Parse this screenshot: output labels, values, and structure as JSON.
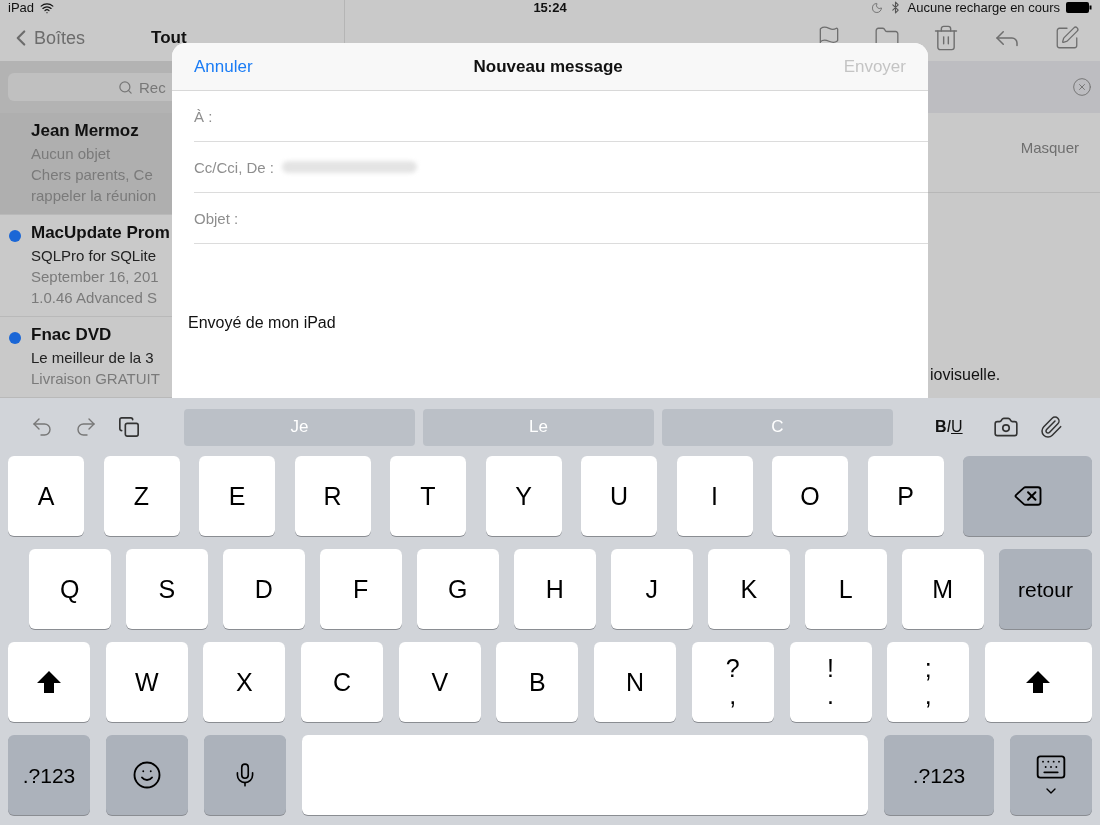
{
  "status_bar": {
    "carrier": "iPad",
    "time": "15:24",
    "charging": "Aucune recharge en cours"
  },
  "mailbox": {
    "back": "Boîtes",
    "title": "Tout",
    "search_placeholder": "Rec",
    "messages": [
      {
        "sender": "Jean Mermoz",
        "subject": "Aucun objet",
        "preview": [
          "Chers parents, Ce",
          "rappeler la réunion"
        ],
        "selected": true,
        "unread": false
      },
      {
        "sender": "MacUpdate Prom",
        "subject": "SQLPro for SQLite",
        "preview": [
          "September 16, 201",
          "1.0.46 Advanced S"
        ],
        "selected": false,
        "unread": true
      },
      {
        "sender": "Fnac DVD",
        "subject": "Le meilleur de la 3",
        "preview": [
          "Livraison GRATUIT"
        ],
        "selected": false,
        "unread": true
      }
    ]
  },
  "reader": {
    "hide": "Masquer",
    "body_fragment": "iovisuelle."
  },
  "compose": {
    "cancel": "Annuler",
    "title": "Nouveau message",
    "send": "Envoyer",
    "send_disabled": true,
    "fields": [
      {
        "label": "À :"
      },
      {
        "label": "Cc/Cci, De :",
        "blurred_value": true
      },
      {
        "label": "Objet :"
      }
    ],
    "signature": "Envoyé de mon iPad"
  },
  "keyboard": {
    "suggestions": [
      "Je",
      "Le",
      "C"
    ],
    "format": [
      "B",
      "I",
      "U"
    ],
    "rows": [
      {
        "keys": [
          {
            "kind": "letter",
            "label": "A"
          },
          {
            "kind": "letter",
            "label": "Z"
          },
          {
            "kind": "letter",
            "label": "E"
          },
          {
            "kind": "letter",
            "label": "R"
          },
          {
            "kind": "letter",
            "label": "T"
          },
          {
            "kind": "letter",
            "label": "Y"
          },
          {
            "kind": "letter",
            "label": "U"
          },
          {
            "kind": "letter",
            "label": "I"
          },
          {
            "kind": "letter",
            "label": "O"
          },
          {
            "kind": "letter",
            "label": "P"
          },
          {
            "kind": "delete"
          }
        ]
      },
      {
        "keys": [
          {
            "kind": "letter",
            "label": "Q"
          },
          {
            "kind": "letter",
            "label": "S"
          },
          {
            "kind": "letter",
            "label": "D"
          },
          {
            "kind": "letter",
            "label": "F"
          },
          {
            "kind": "letter",
            "label": "G"
          },
          {
            "kind": "letter",
            "label": "H"
          },
          {
            "kind": "letter",
            "label": "J"
          },
          {
            "kind": "letter",
            "label": "K"
          },
          {
            "kind": "letter",
            "label": "L"
          },
          {
            "kind": "letter",
            "label": "M"
          },
          {
            "kind": "return",
            "label": "retour"
          }
        ]
      },
      {
        "keys": [
          {
            "kind": "shift"
          },
          {
            "kind": "letter",
            "label": "W"
          },
          {
            "kind": "letter",
            "label": "X"
          },
          {
            "kind": "letter",
            "label": "C"
          },
          {
            "kind": "letter",
            "label": "V"
          },
          {
            "kind": "letter",
            "label": "B"
          },
          {
            "kind": "letter",
            "label": "N"
          },
          {
            "kind": "symbol",
            "label": "?",
            "sub": ","
          },
          {
            "kind": "symbol",
            "label": "!",
            "sub": "."
          },
          {
            "kind": "symbol",
            "label": ";",
            "sub": ","
          },
          {
            "kind": "shift"
          }
        ]
      },
      {
        "keys": [
          {
            "kind": "numbers",
            "label": ".?123"
          },
          {
            "kind": "emoji"
          },
          {
            "kind": "mic"
          },
          {
            "kind": "space"
          },
          {
            "kind": "numbers",
            "label": ".?123"
          },
          {
            "kind": "dismiss"
          }
        ]
      }
    ]
  }
}
